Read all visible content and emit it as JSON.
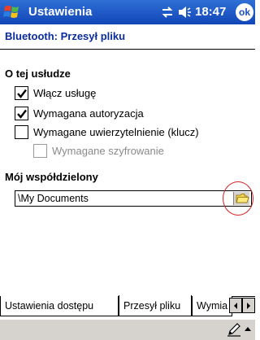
{
  "titlebar": {
    "app_title": "Ustawienia",
    "clock": "18:47",
    "ok_label": "ok",
    "accent_color": "#1a4fbf"
  },
  "page": {
    "heading": "Bluetooth: Przesył pliku"
  },
  "service": {
    "section_label": "O tej usłudze",
    "options": [
      {
        "label": "Włącz usługę",
        "checked": true,
        "enabled": true
      },
      {
        "label": "Wymagana autoryzacja",
        "checked": true,
        "enabled": true
      },
      {
        "label": "Wymagane uwierzytelnienie (klucz)",
        "checked": false,
        "enabled": true
      },
      {
        "label": "Wymagane szyfrowanie",
        "checked": false,
        "enabled": false
      }
    ]
  },
  "shared": {
    "section_label": "Mój współdzielony",
    "folder_value": "\\My Documents",
    "folder_icon": "folder-icon"
  },
  "tabs": [
    {
      "label": "Ustawienia dostępu",
      "active": false
    },
    {
      "label": "Przesył pliku",
      "active": true
    },
    {
      "label": "Wymia",
      "active": false
    }
  ],
  "menubar": {
    "input_icon": "pen-icon"
  }
}
